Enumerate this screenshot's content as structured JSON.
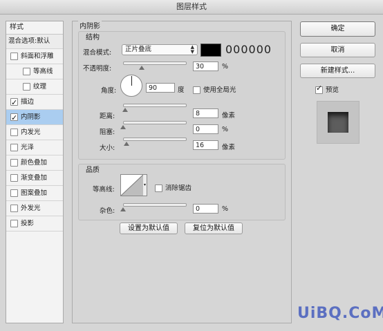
{
  "window": {
    "title": "图层样式"
  },
  "sidebar": {
    "header": "样式",
    "blend_options": "混合选项:默认",
    "items": [
      {
        "label": "斜面和浮雕",
        "checked": false,
        "sub": false,
        "active": false
      },
      {
        "label": "等高线",
        "checked": false,
        "sub": true,
        "active": false
      },
      {
        "label": "纹理",
        "checked": false,
        "sub": true,
        "active": false
      },
      {
        "label": "描边",
        "checked": true,
        "sub": false,
        "active": false
      },
      {
        "label": "内阴影",
        "checked": true,
        "sub": false,
        "active": true
      },
      {
        "label": "内发光",
        "checked": false,
        "sub": false,
        "active": false
      },
      {
        "label": "光泽",
        "checked": false,
        "sub": false,
        "active": false
      },
      {
        "label": "颜色叠加",
        "checked": false,
        "sub": false,
        "active": false
      },
      {
        "label": "渐变叠加",
        "checked": false,
        "sub": false,
        "active": false
      },
      {
        "label": "图案叠加",
        "checked": false,
        "sub": false,
        "active": false
      },
      {
        "label": "外发光",
        "checked": false,
        "sub": false,
        "active": false
      },
      {
        "label": "投影",
        "checked": false,
        "sub": false,
        "active": false
      }
    ]
  },
  "panel": {
    "title": "内阴影",
    "structure": {
      "title": "结构",
      "blend_mode_label": "混合模式:",
      "blend_mode_value": "正片叠底",
      "color_hex": "000000",
      "color": "#000000",
      "opacity_label": "不透明度:",
      "opacity_value": "30",
      "opacity_unit": "%",
      "opacity_fraction": 0.3,
      "angle_label": "角度:",
      "angle_value": "90",
      "angle_unit": "度",
      "global_light_label": "使用全局光",
      "global_light_checked": false,
      "distance_label": "距离:",
      "distance_value": "8",
      "distance_unit": "像素",
      "distance_fraction": 0.03,
      "choke_label": "阻塞:",
      "choke_value": "0",
      "choke_unit": "%",
      "choke_fraction": 0.0,
      "size_label": "大小:",
      "size_value": "16",
      "size_unit": "像素",
      "size_fraction": 0.06
    },
    "quality": {
      "title": "品质",
      "contour_label": "等高线:",
      "antialias_label": "消除锯齿",
      "antialias_checked": false,
      "noise_label": "杂色:",
      "noise_value": "0",
      "noise_unit": "%",
      "noise_fraction": 0.0
    },
    "buttons": {
      "make_default": "设置为默认值",
      "reset_default": "复位为默认值"
    }
  },
  "right": {
    "ok": "确定",
    "cancel": "取消",
    "new_style": "新建样式...",
    "preview_label": "预览",
    "preview_checked": true
  },
  "watermark": "UiBQ.CoM"
}
